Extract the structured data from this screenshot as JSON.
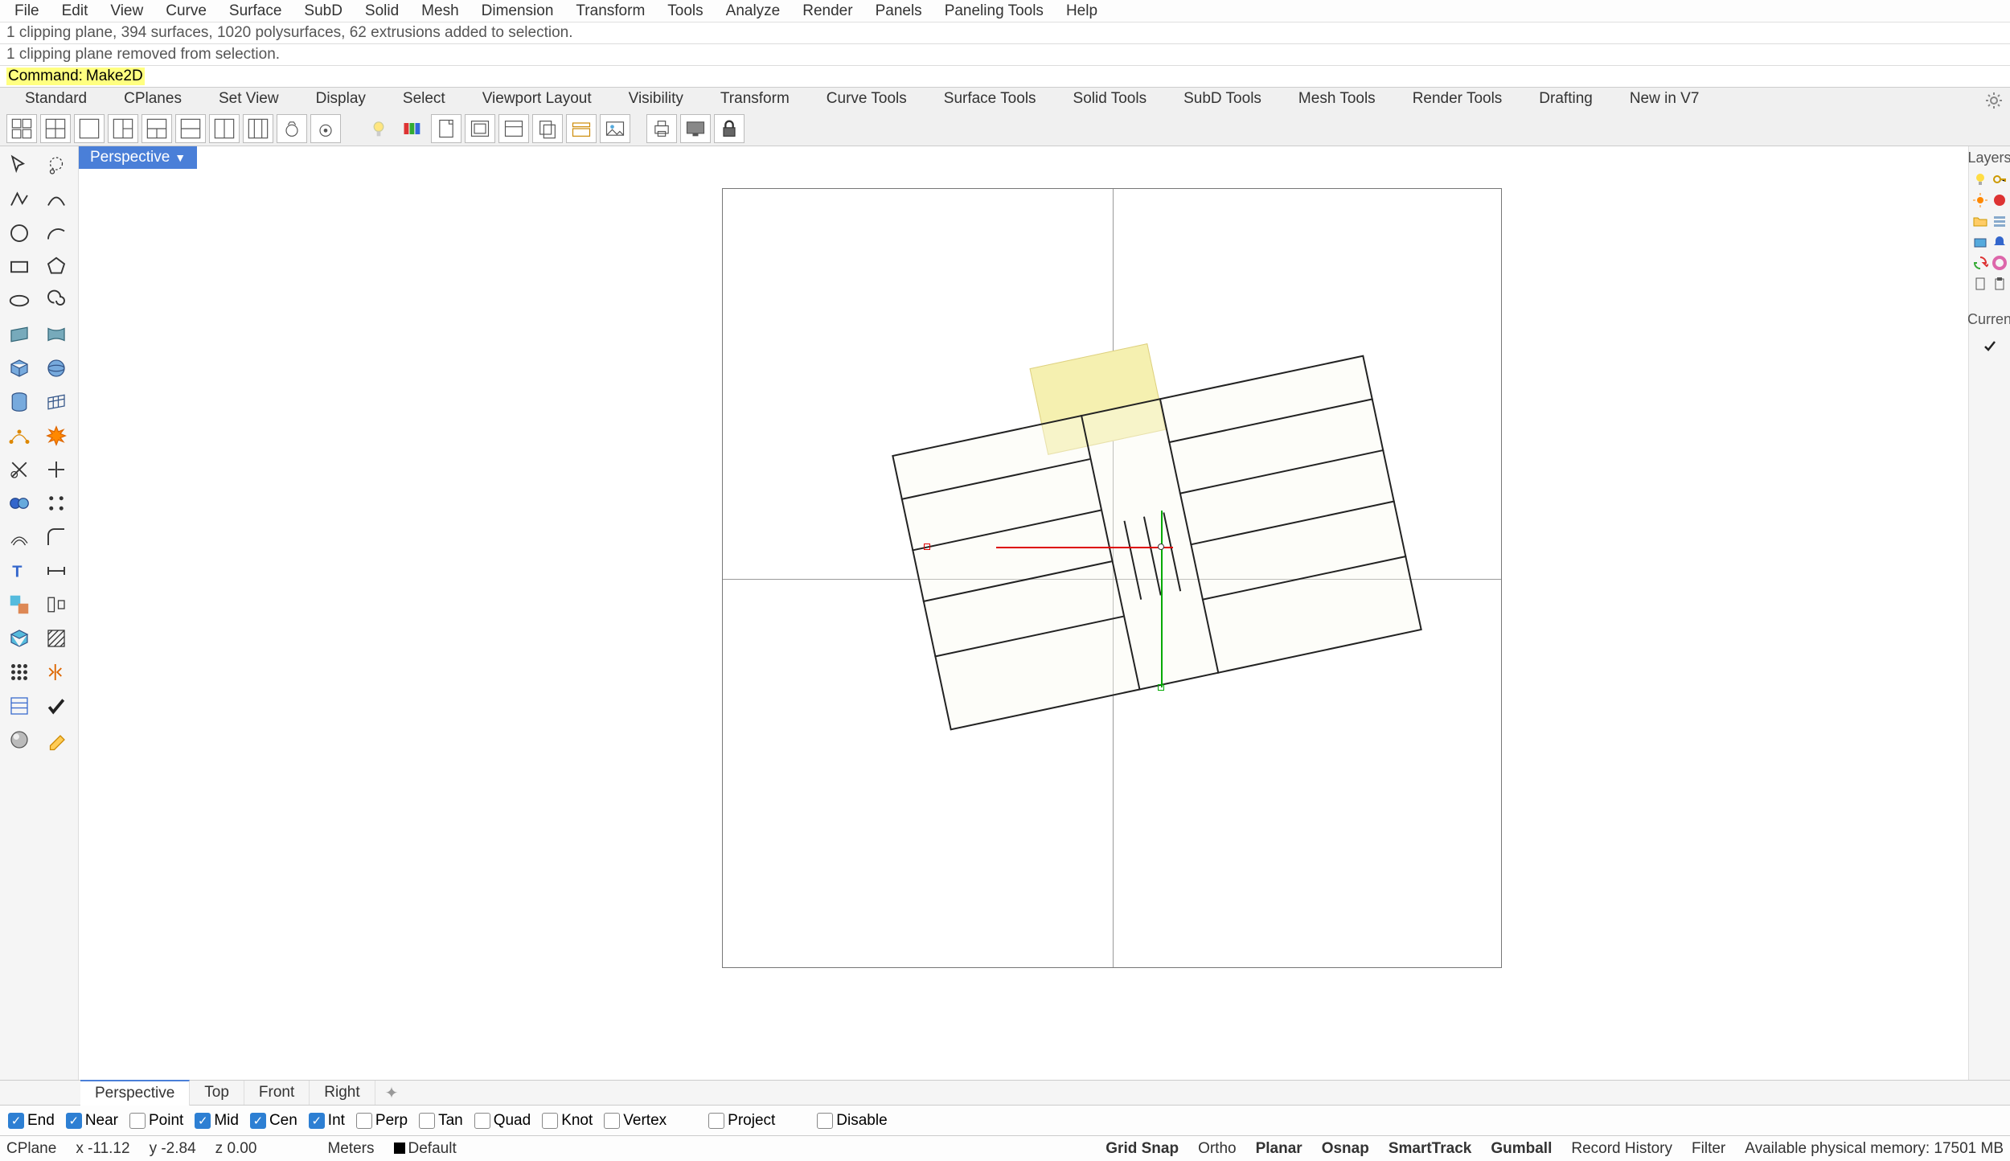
{
  "menu": [
    "File",
    "Edit",
    "View",
    "Curve",
    "Surface",
    "SubD",
    "Solid",
    "Mesh",
    "Dimension",
    "Transform",
    "Tools",
    "Analyze",
    "Render",
    "Panels",
    "Paneling Tools",
    "Help"
  ],
  "cmd_history": [
    "1 clipping plane, 394 surfaces, 1020 polysurfaces, 62 extrusions added to selection.",
    "1 clipping plane removed from selection."
  ],
  "cmd_prompt_label": "Command:",
  "cmd_prompt_text": "Make2D",
  "tabs": [
    "Standard",
    "CPlanes",
    "Set View",
    "Display",
    "Select",
    "Viewport Layout",
    "Visibility",
    "Transform",
    "Curve Tools",
    "Surface Tools",
    "Solid Tools",
    "SubD Tools",
    "Mesh Tools",
    "Render Tools",
    "Drafting",
    "New in V7"
  ],
  "viewport_name": "Perspective",
  "view_tabs": [
    "Perspective",
    "Top",
    "Front",
    "Right"
  ],
  "right_panel": {
    "title": "Layers",
    "curren": "Curren"
  },
  "osnaps": [
    {
      "label": "End",
      "on": true
    },
    {
      "label": "Near",
      "on": true
    },
    {
      "label": "Point",
      "on": false
    },
    {
      "label": "Mid",
      "on": true
    },
    {
      "label": "Cen",
      "on": true
    },
    {
      "label": "Int",
      "on": true
    },
    {
      "label": "Perp",
      "on": false
    },
    {
      "label": "Tan",
      "on": false
    },
    {
      "label": "Quad",
      "on": false
    },
    {
      "label": "Knot",
      "on": false
    },
    {
      "label": "Vertex",
      "on": false
    }
  ],
  "osnap_tail": [
    "Project",
    "Disable"
  ],
  "status": {
    "cplane": "CPlane",
    "x": "x -11.12",
    "y": "y -2.84",
    "z": "z 0.00",
    "units": "Meters",
    "layer": "Default",
    "toggles": [
      "Grid Snap",
      "Ortho",
      "Planar",
      "Osnap",
      "SmartTrack",
      "Gumball",
      "Record History",
      "Filter"
    ],
    "toggles_bold": [
      true,
      false,
      true,
      true,
      true,
      true,
      false,
      false
    ],
    "memory": "Available physical memory: 17501 MB"
  }
}
